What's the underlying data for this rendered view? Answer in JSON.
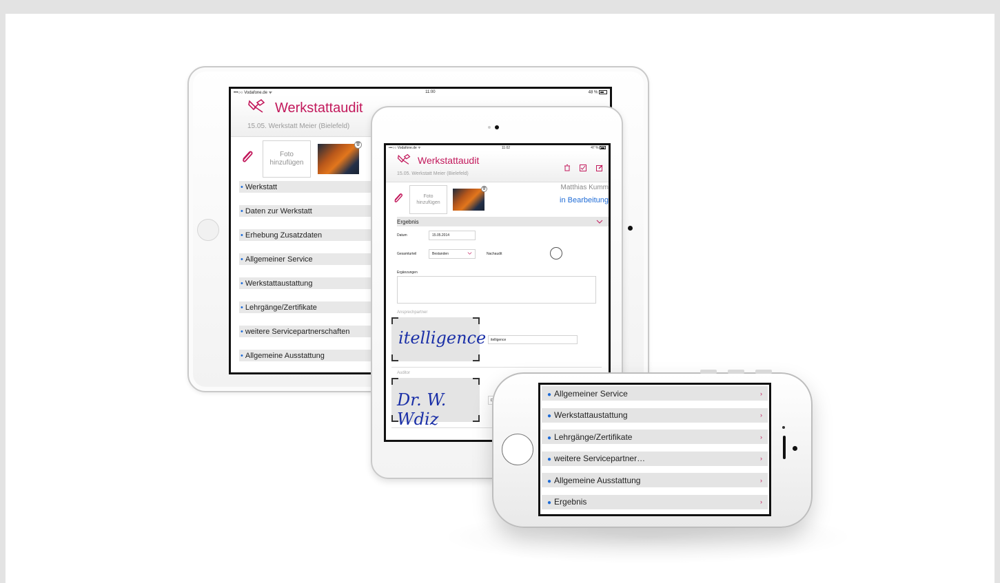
{
  "ipad_large": {
    "status": {
      "carrier": "•••○○ Vodafone.de ᯤ",
      "time": "11:00",
      "battery": "48 %"
    },
    "title": "Werkstattaudit",
    "subtitle": "15.05. Werkstatt Meier (Bielefeld)",
    "foto_label": "Foto hinzufügen",
    "nav_items": [
      "Werkstatt",
      "Daten zur Werkstatt",
      "Erhebung Zusatzdaten",
      "Allgemeiner Service",
      "Werkstattaustattung",
      "Lehrgänge/Zertifikate",
      "weitere Servicepartnerschaften",
      "Allgemeine Ausstattung"
    ]
  },
  "ipad_small": {
    "status": {
      "carrier": "•••○○ Vodafone.de ᯤ",
      "time": "11:02",
      "battery": "47 %"
    },
    "title": "Werkstattaudit",
    "subtitle": "15.05. Werkstatt Meier (Bielefeld)",
    "foto_label": "Foto hinzufügen",
    "user_name": "Matthias Kumm",
    "status_text": "in Bearbeitung",
    "section_title": "Ergebnis",
    "datum_label": "Datum",
    "datum_value": "15.05.2014",
    "gesamturteil_label": "Gesamturteil",
    "gesamturteil_value": "Bestanden",
    "nachaudit_label": "Nachaudit",
    "ergaenzungen_label": "Ergänzungen",
    "ansprechpartner_label": "Ansprechpartner",
    "ansprechpartner_sig": "itelligence",
    "ansprechpartner_name": "itelligence",
    "auditor_label": "Auditor",
    "auditor_sig": "Dr. W. Wdiz",
    "auditor_name": "D"
  },
  "iphone": {
    "items": [
      "Allgemeiner Service",
      "Werkstattaustattung",
      "Lehrgänge/Zertifikate",
      "weitere Servicepartner…",
      "Allgemeine Ausstattung",
      "Ergebnis"
    ],
    "chevron": "›"
  },
  "colors": {
    "accent": "#c2185b",
    "link": "#1e6bd6",
    "bullet": "#1e6bd6"
  },
  "icons": [
    "tool-icon",
    "paperclip-icon",
    "trash-icon",
    "checkbox-icon",
    "edit-icon",
    "chevron-down-icon",
    "chevron-right-icon"
  ]
}
